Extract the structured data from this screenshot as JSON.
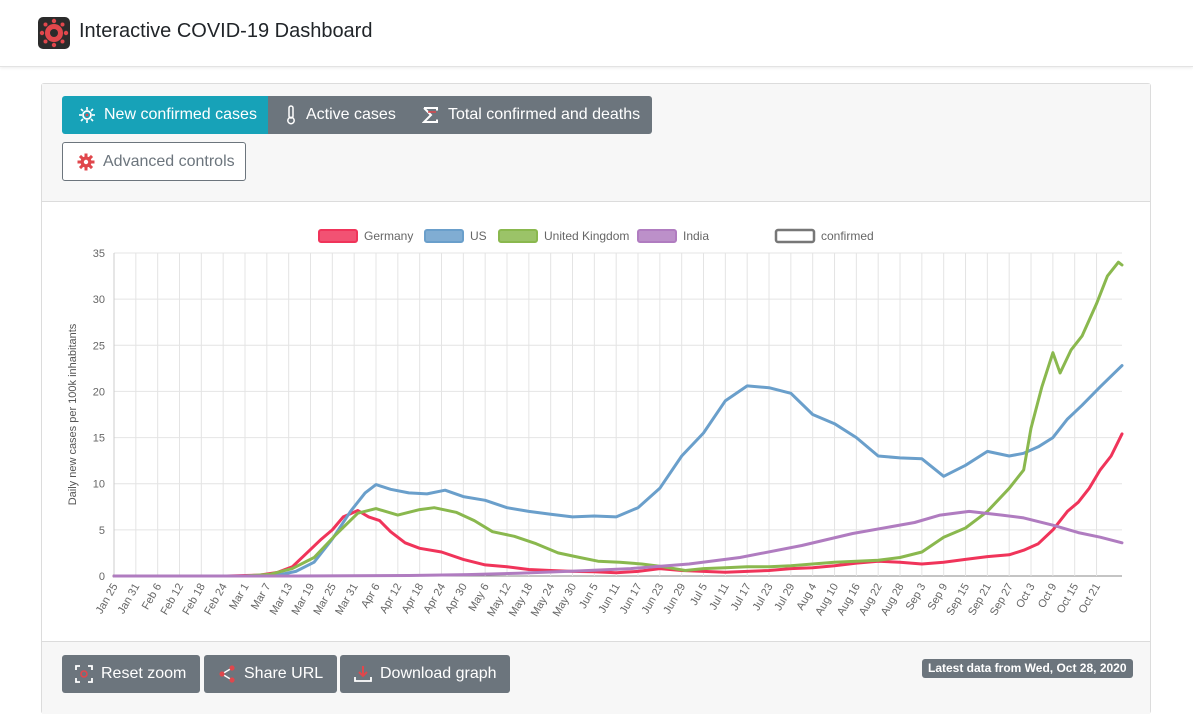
{
  "app": {
    "title": "Interactive COVID-19 Dashboard"
  },
  "tabs": [
    {
      "label": "New confirmed cases",
      "icon": "virus-icon",
      "active": true
    },
    {
      "label": "Active cases",
      "icon": "thermometer-icon",
      "active": false
    },
    {
      "label": "Total confirmed and deaths",
      "icon": "sigma-icon",
      "active": false
    }
  ],
  "advanced": {
    "label": "Advanced controls",
    "icon": "gear-icon"
  },
  "footer": {
    "reset_label": "Reset zoom",
    "share_label": "Share URL",
    "download_label": "Download graph",
    "latest": "Latest data from Wed, Oct 28, 2020"
  },
  "colors": {
    "accent": "#17a2b8",
    "secondary": "#6c757d"
  },
  "chart_data": {
    "type": "line",
    "ylabel": "Daily new cases per 100k inhabitants",
    "ylim": [
      0,
      35
    ],
    "yticks": [
      0,
      5,
      10,
      15,
      20,
      25,
      30,
      35
    ],
    "grid": true,
    "legend_position": "top",
    "legend_style_entry": "confirmed",
    "x_range": [
      "2020-01-25",
      "2020-10-28"
    ],
    "xticks": [
      "Jan 25",
      "Jan 31",
      "Feb 6",
      "Feb 12",
      "Feb 18",
      "Feb 24",
      "Mar 1",
      "Mar 7",
      "Mar 13",
      "Mar 19",
      "Mar 25",
      "Mar 31",
      "Apr 6",
      "Apr 12",
      "Apr 18",
      "Apr 24",
      "Apr 30",
      "May 6",
      "May 12",
      "May 18",
      "May 24",
      "May 30",
      "Jun 5",
      "Jun 11",
      "Jun 17",
      "Jun 23",
      "Jun 29",
      "Jul 5",
      "Jul 11",
      "Jul 17",
      "Jul 23",
      "Jul 29",
      "Aug 4",
      "Aug 10",
      "Aug 16",
      "Aug 22",
      "Aug 28",
      "Sep 3",
      "Sep 9",
      "Sep 15",
      "Sep 21",
      "Sep 27",
      "Oct 3",
      "Oct 9",
      "Oct 15",
      "Oct 21"
    ],
    "series": [
      {
        "name": "Germany",
        "color": "#f0345a",
        "points": [
          [
            "2020-01-25",
            0
          ],
          [
            "2020-02-25",
            0
          ],
          [
            "2020-03-05",
            0.1
          ],
          [
            "2020-03-10",
            0.4
          ],
          [
            "2020-03-14",
            1.0
          ],
          [
            "2020-03-18",
            2.5
          ],
          [
            "2020-03-22",
            4.0
          ],
          [
            "2020-03-25",
            5.0
          ],
          [
            "2020-03-28",
            6.4
          ],
          [
            "2020-04-01",
            7.1
          ],
          [
            "2020-04-04",
            6.4
          ],
          [
            "2020-04-07",
            6.0
          ],
          [
            "2020-04-10",
            4.8
          ],
          [
            "2020-04-14",
            3.6
          ],
          [
            "2020-04-18",
            3.0
          ],
          [
            "2020-04-24",
            2.6
          ],
          [
            "2020-04-30",
            1.8
          ],
          [
            "2020-05-06",
            1.2
          ],
          [
            "2020-05-12",
            1.0
          ],
          [
            "2020-05-18",
            0.7
          ],
          [
            "2020-05-24",
            0.6
          ],
          [
            "2020-05-30",
            0.5
          ],
          [
            "2020-06-05",
            0.45
          ],
          [
            "2020-06-11",
            0.35
          ],
          [
            "2020-06-17",
            0.5
          ],
          [
            "2020-06-23",
            0.8
          ],
          [
            "2020-06-29",
            0.6
          ],
          [
            "2020-07-05",
            0.5
          ],
          [
            "2020-07-11",
            0.4
          ],
          [
            "2020-07-17",
            0.5
          ],
          [
            "2020-07-23",
            0.6
          ],
          [
            "2020-07-29",
            0.8
          ],
          [
            "2020-08-04",
            0.9
          ],
          [
            "2020-08-10",
            1.1
          ],
          [
            "2020-08-16",
            1.4
          ],
          [
            "2020-08-22",
            1.6
          ],
          [
            "2020-08-28",
            1.5
          ],
          [
            "2020-09-03",
            1.3
          ],
          [
            "2020-09-09",
            1.5
          ],
          [
            "2020-09-15",
            1.8
          ],
          [
            "2020-09-21",
            2.1
          ],
          [
            "2020-09-27",
            2.3
          ],
          [
            "2020-10-01",
            2.8
          ],
          [
            "2020-10-05",
            3.5
          ],
          [
            "2020-10-09",
            5.0
          ],
          [
            "2020-10-13",
            7.0
          ],
          [
            "2020-10-16",
            8.0
          ],
          [
            "2020-10-19",
            9.5
          ],
          [
            "2020-10-22",
            11.5
          ],
          [
            "2020-10-25",
            13.0
          ],
          [
            "2020-10-28",
            15.4
          ]
        ]
      },
      {
        "name": "US",
        "color": "#6a9fcb",
        "points": [
          [
            "2020-01-25",
            0
          ],
          [
            "2020-03-01",
            0
          ],
          [
            "2020-03-10",
            0.1
          ],
          [
            "2020-03-15",
            0.5
          ],
          [
            "2020-03-20",
            1.5
          ],
          [
            "2020-03-25",
            4.0
          ],
          [
            "2020-03-30",
            7.0
          ],
          [
            "2020-04-03",
            9.0
          ],
          [
            "2020-04-06",
            9.9
          ],
          [
            "2020-04-10",
            9.4
          ],
          [
            "2020-04-15",
            9.0
          ],
          [
            "2020-04-20",
            8.9
          ],
          [
            "2020-04-25",
            9.3
          ],
          [
            "2020-04-30",
            8.6
          ],
          [
            "2020-05-06",
            8.2
          ],
          [
            "2020-05-12",
            7.4
          ],
          [
            "2020-05-18",
            7.0
          ],
          [
            "2020-05-24",
            6.7
          ],
          [
            "2020-05-30",
            6.4
          ],
          [
            "2020-06-05",
            6.5
          ],
          [
            "2020-06-11",
            6.4
          ],
          [
            "2020-06-17",
            7.4
          ],
          [
            "2020-06-23",
            9.5
          ],
          [
            "2020-06-29",
            13.0
          ],
          [
            "2020-07-05",
            15.5
          ],
          [
            "2020-07-11",
            19.0
          ],
          [
            "2020-07-17",
            20.6
          ],
          [
            "2020-07-23",
            20.4
          ],
          [
            "2020-07-29",
            19.8
          ],
          [
            "2020-08-04",
            17.5
          ],
          [
            "2020-08-10",
            16.5
          ],
          [
            "2020-08-16",
            15.0
          ],
          [
            "2020-08-22",
            13.0
          ],
          [
            "2020-08-28",
            12.8
          ],
          [
            "2020-09-03",
            12.7
          ],
          [
            "2020-09-09",
            10.8
          ],
          [
            "2020-09-15",
            12.0
          ],
          [
            "2020-09-21",
            13.5
          ],
          [
            "2020-09-27",
            13.0
          ],
          [
            "2020-10-01",
            13.3
          ],
          [
            "2020-10-05",
            14.0
          ],
          [
            "2020-10-09",
            15.0
          ],
          [
            "2020-10-13",
            17.0
          ],
          [
            "2020-10-17",
            18.5
          ],
          [
            "2020-10-22",
            20.5
          ],
          [
            "2020-10-28",
            22.8
          ]
        ]
      },
      {
        "name": "United Kingdom",
        "color": "#8ab84e",
        "points": [
          [
            "2020-01-25",
            0
          ],
          [
            "2020-03-01",
            0
          ],
          [
            "2020-03-08",
            0.2
          ],
          [
            "2020-03-14",
            0.8
          ],
          [
            "2020-03-20",
            2.0
          ],
          [
            "2020-03-26",
            4.5
          ],
          [
            "2020-04-01",
            6.8
          ],
          [
            "2020-04-06",
            7.3
          ],
          [
            "2020-04-12",
            6.6
          ],
          [
            "2020-04-18",
            7.2
          ],
          [
            "2020-04-22",
            7.4
          ],
          [
            "2020-04-28",
            6.9
          ],
          [
            "2020-05-03",
            6.0
          ],
          [
            "2020-05-08",
            4.8
          ],
          [
            "2020-05-14",
            4.3
          ],
          [
            "2020-05-20",
            3.5
          ],
          [
            "2020-05-26",
            2.5
          ],
          [
            "2020-06-01",
            2.0
          ],
          [
            "2020-06-06",
            1.6
          ],
          [
            "2020-06-12",
            1.5
          ],
          [
            "2020-06-18",
            1.3
          ],
          [
            "2020-06-24",
            1.0
          ],
          [
            "2020-06-30",
            0.6
          ],
          [
            "2020-07-05",
            0.8
          ],
          [
            "2020-07-11",
            0.9
          ],
          [
            "2020-07-17",
            1.0
          ],
          [
            "2020-07-23",
            1.0
          ],
          [
            "2020-07-29",
            1.1
          ],
          [
            "2020-08-04",
            1.3
          ],
          [
            "2020-08-10",
            1.5
          ],
          [
            "2020-08-16",
            1.6
          ],
          [
            "2020-08-22",
            1.7
          ],
          [
            "2020-08-28",
            2.0
          ],
          [
            "2020-09-03",
            2.6
          ],
          [
            "2020-09-09",
            4.2
          ],
          [
            "2020-09-15",
            5.2
          ],
          [
            "2020-09-21",
            7.0
          ],
          [
            "2020-09-27",
            9.5
          ],
          [
            "2020-10-01",
            11.5
          ],
          [
            "2020-10-03",
            16.0
          ],
          [
            "2020-10-06",
            20.5
          ],
          [
            "2020-10-09",
            24.2
          ],
          [
            "2020-10-11",
            22.0
          ],
          [
            "2020-10-14",
            24.5
          ],
          [
            "2020-10-17",
            26.0
          ],
          [
            "2020-10-21",
            29.5
          ],
          [
            "2020-10-24",
            32.5
          ],
          [
            "2020-10-27",
            34.0
          ],
          [
            "2020-10-28",
            33.7
          ]
        ]
      },
      {
        "name": "India",
        "color": "#b07cc0",
        "points": [
          [
            "2020-01-25",
            0
          ],
          [
            "2020-03-15",
            0
          ],
          [
            "2020-04-15",
            0.05
          ],
          [
            "2020-05-01",
            0.15
          ],
          [
            "2020-05-15",
            0.3
          ],
          [
            "2020-06-01",
            0.55
          ],
          [
            "2020-06-15",
            0.8
          ],
          [
            "2020-07-01",
            1.3
          ],
          [
            "2020-07-15",
            2.0
          ],
          [
            "2020-08-01",
            3.3
          ],
          [
            "2020-08-15",
            4.6
          ],
          [
            "2020-09-01",
            5.8
          ],
          [
            "2020-09-08",
            6.6
          ],
          [
            "2020-09-16",
            7.0
          ],
          [
            "2020-09-25",
            6.6
          ],
          [
            "2020-10-01",
            6.3
          ],
          [
            "2020-10-09",
            5.5
          ],
          [
            "2020-10-16",
            4.7
          ],
          [
            "2020-10-22",
            4.2
          ],
          [
            "2020-10-28",
            3.6
          ]
        ]
      }
    ]
  }
}
